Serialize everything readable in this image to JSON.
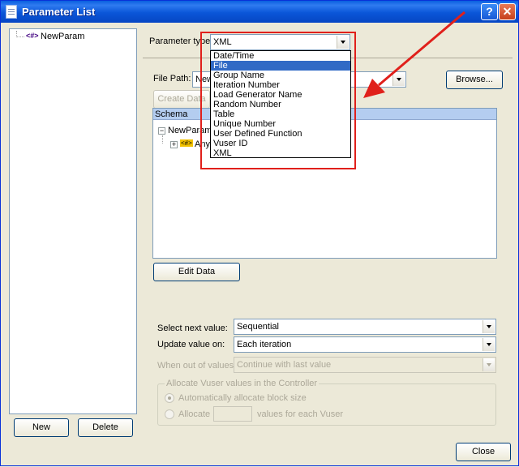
{
  "window": {
    "title": "Parameter List",
    "help_label": "?",
    "close_label": "✕"
  },
  "tree": {
    "items": [
      {
        "prefix": "<#>",
        "label": "NewParam"
      }
    ]
  },
  "left_buttons": {
    "new": "New",
    "delete": "Delete"
  },
  "parameter_type": {
    "label": "Parameter type:",
    "value": "XML"
  },
  "dropdown_options": [
    {
      "label": "Date/Time",
      "selected": false
    },
    {
      "label": "File",
      "selected": true
    },
    {
      "label": "Group Name",
      "selected": false
    },
    {
      "label": "Iteration Number",
      "selected": false
    },
    {
      "label": "Load Generator Name",
      "selected": false
    },
    {
      "label": "Random Number",
      "selected": false
    },
    {
      "label": "Table",
      "selected": false
    },
    {
      "label": "Unique Number",
      "selected": false
    },
    {
      "label": "User Defined Function",
      "selected": false
    },
    {
      "label": "Vuser ID",
      "selected": false
    },
    {
      "label": "XML",
      "selected": false
    }
  ],
  "file_path": {
    "label": "File Path:",
    "value": "New"
  },
  "buttons": {
    "browse": "Browse...",
    "create_data": "Create Data",
    "edit_data": "Edit Data",
    "close": "Close"
  },
  "schema": {
    "header": "Schema",
    "root": "NewParam",
    "child_icon": "<#>",
    "child": "Any"
  },
  "select_next": {
    "label": "Select next value:",
    "value": "Sequential"
  },
  "update_value": {
    "label": "Update value on:",
    "value": "Each iteration"
  },
  "out_of_values": {
    "label": "When out of values:",
    "value": "Continue with last value"
  },
  "allocate_group": {
    "legend": "Allocate Vuser values in the Controller",
    "auto_label": "Automatically allocate block size",
    "allocate_label": "Allocate",
    "allocate_suffix": "values for each Vuser"
  },
  "colors": {
    "annotation_red": "#e0201b",
    "selection_blue": "#316ac5",
    "schema_header": "#b4cdf0"
  },
  "annotation": {
    "arrow_icon": "red-arrow-icon",
    "highlight": "red-highlight-box"
  }
}
